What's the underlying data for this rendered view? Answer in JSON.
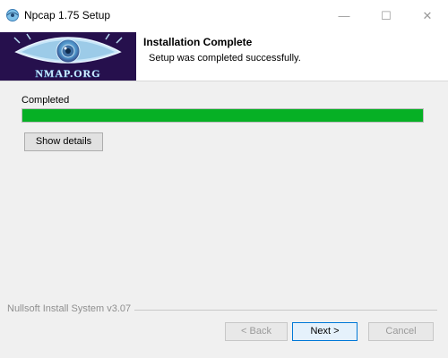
{
  "window": {
    "title": "Npcap 1.75 Setup",
    "icon": "npcap-app-icon",
    "controls": {
      "minimize": "—",
      "maximize": "☐",
      "close": "✕"
    }
  },
  "header": {
    "logo_text": "NMAP.ORG",
    "title": "Installation Complete",
    "subtitle": "Setup was completed successfully."
  },
  "main": {
    "status_label": "Completed",
    "progress_percent": 100,
    "progress_color": "#06b025",
    "show_details_label": "Show details"
  },
  "footer": {
    "branding": "Nullsoft Install System v3.07",
    "back_label": "< Back",
    "next_label": "Next >",
    "cancel_label": "Cancel"
  }
}
